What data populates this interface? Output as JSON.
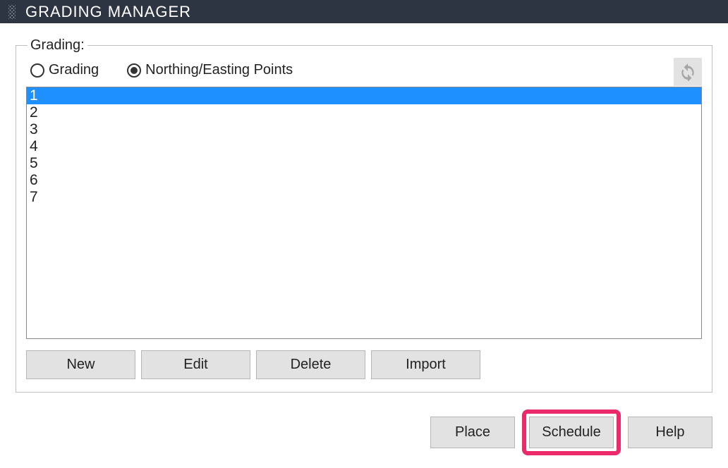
{
  "titlebar": {
    "title": "GRADING MANAGER"
  },
  "fieldset": {
    "legend": "Grading:"
  },
  "radios": {
    "grading": {
      "label": "Grading",
      "selected": false
    },
    "northing_easting": {
      "label": "Northing/Easting Points",
      "selected": true
    }
  },
  "list": {
    "items": [
      "1",
      "2",
      "3",
      "4",
      "5",
      "6",
      "7"
    ],
    "selected_index": 0
  },
  "buttons": {
    "new": "New",
    "edit": "Edit",
    "delete": "Delete",
    "import": "Import",
    "place": "Place",
    "schedule": "Schedule",
    "help": "Help"
  }
}
